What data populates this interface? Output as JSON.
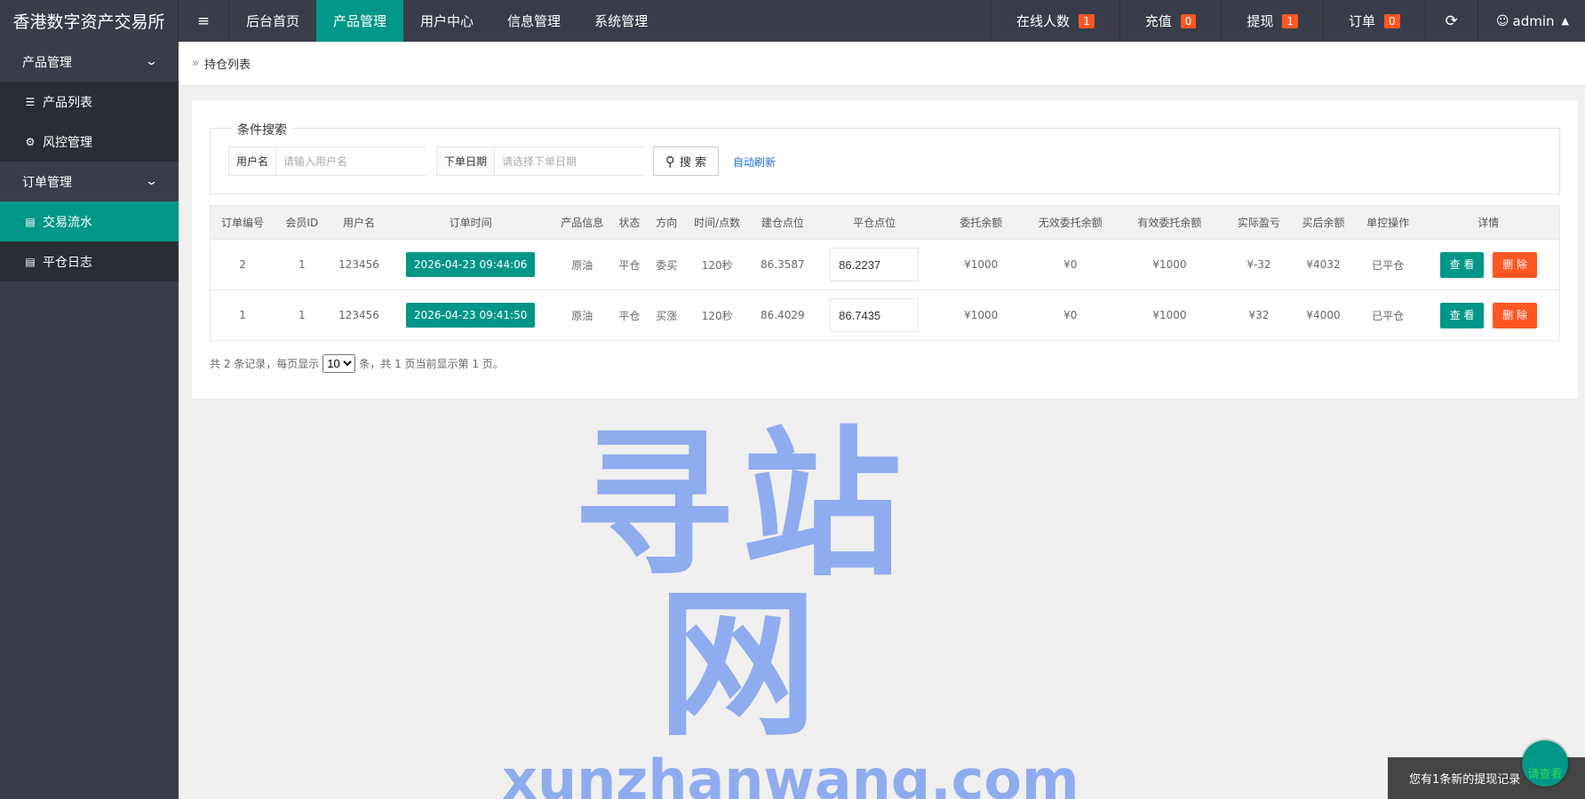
{
  "header": {
    "logo": "香港数字资产交易所",
    "menu_icon": "≡",
    "nav": [
      {
        "label": "后台首页",
        "active": false
      },
      {
        "label": "产品管理",
        "active": true
      },
      {
        "label": "用户中心",
        "active": false
      },
      {
        "label": "信息管理",
        "active": false
      },
      {
        "label": "系统管理",
        "active": false
      }
    ],
    "right": {
      "online": {
        "label": "在线人数",
        "count": "1"
      },
      "recharge": {
        "label": "充值",
        "count": "0"
      },
      "withdraw": {
        "label": "提现",
        "count": "1"
      },
      "orders": {
        "label": "订单",
        "count": "0"
      },
      "refresh_icon": "⟳",
      "user": "admin"
    }
  },
  "sidebar": {
    "groups": [
      {
        "label": "产品管理",
        "items": [
          {
            "label": "产品列表",
            "icon": "layers-icon"
          },
          {
            "label": "风控管理",
            "icon": "gear-icon"
          }
        ]
      },
      {
        "label": "订单管理",
        "items": [
          {
            "label": "交易流水",
            "icon": "file-icon",
            "active": true
          },
          {
            "label": "平仓日志",
            "icon": "file-icon"
          }
        ]
      }
    ]
  },
  "breadcrumb": {
    "label": "持仓列表"
  },
  "search": {
    "legend": "条件搜索",
    "username_label": "用户名",
    "username_placeholder": "请输入用户名",
    "date_label": "下单日期",
    "date_placeholder": "请选择下单日期",
    "search_button": "搜 索",
    "auto_refresh": "自动刷新"
  },
  "table": {
    "headers": [
      "订单编号",
      "会员ID",
      "用户名",
      "订单时间",
      "产品信息",
      "状态",
      "方向",
      "时间/点数",
      "建仓点位",
      "平仓点位",
      "委托余额",
      "无效委托余额",
      "有效委托余额",
      "实际盈亏",
      "买后余额",
      "单控操作",
      "详情"
    ],
    "rows": [
      {
        "id": "2",
        "member_id": "1",
        "username": "123456",
        "time": "2026-04-23 09:44:06",
        "product": "原油",
        "status": "平仓",
        "direction": "委买",
        "direction_color": "blue",
        "duration": "120秒",
        "open_price": "86.3587",
        "close_price": "86.2237",
        "entrust": "¥1000",
        "invalid": "¥0",
        "valid": "¥1000",
        "pnl": "¥-32",
        "pnl_color": "green",
        "balance": "¥4032",
        "control": "已平仓",
        "view": "查 看",
        "delete": "删 除"
      },
      {
        "id": "1",
        "member_id": "1",
        "username": "123456",
        "time": "2026-04-23 09:41:50",
        "product": "原油",
        "status": "平仓",
        "direction": "买涨",
        "direction_color": "red",
        "duration": "120秒",
        "open_price": "86.4029",
        "close_price": "86.7435",
        "entrust": "¥1000",
        "invalid": "¥0",
        "valid": "¥1000",
        "pnl": "¥32",
        "pnl_color": "red",
        "balance": "¥4000",
        "control": "已平仓",
        "view": "查 看",
        "delete": "删 除"
      }
    ]
  },
  "pager": {
    "prefix": "共 2 条记录，每页显示",
    "page_size": "10",
    "suffix": "条，共 1 页当前显示第 1 页。"
  },
  "watermark": {
    "cn": "寻站网",
    "en": "xunzhanwang.com"
  },
  "notice": {
    "text": "您有1条新的提现记录",
    "circle_text": "请查看"
  }
}
